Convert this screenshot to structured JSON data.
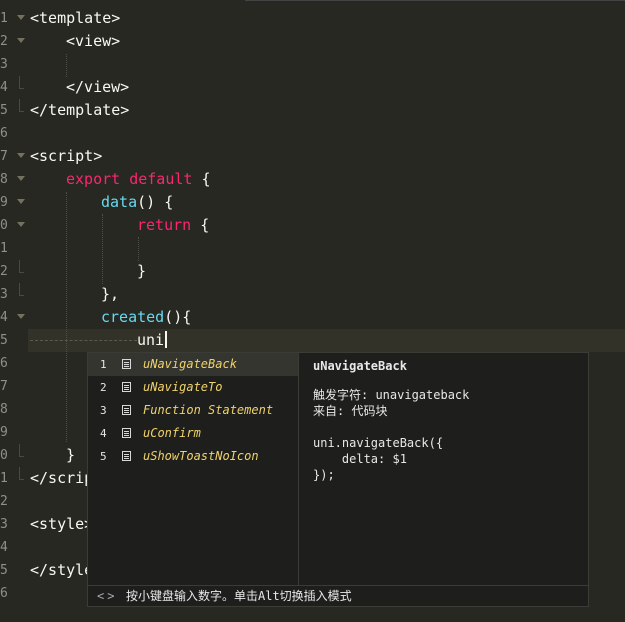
{
  "editor": {
    "lines": [
      {
        "num": "1",
        "code": "<template>"
      },
      {
        "num": "2",
        "code": "<view>"
      },
      {
        "num": "3",
        "code": ""
      },
      {
        "num": "4",
        "code": "</view>"
      },
      {
        "num": "5",
        "code": "</template>"
      },
      {
        "num": "6",
        "code": ""
      },
      {
        "num": "7",
        "code": "<script>"
      },
      {
        "num": "8",
        "code_kw": "export default",
        "code_rest": " {"
      },
      {
        "num": "9",
        "code_fn": "data",
        "code_rest": "() {"
      },
      {
        "num": "0",
        "code_kw": "return",
        "code_rest": " {"
      },
      {
        "num": "1",
        "code": ""
      },
      {
        "num": "2",
        "code": "}"
      },
      {
        "num": "3",
        "code": "},"
      },
      {
        "num": "4",
        "code_fn": "created",
        "code_rest": "(){"
      },
      {
        "num": "5",
        "code": "uni"
      },
      {
        "num": "6",
        "code": ""
      },
      {
        "num": "7",
        "code": ""
      },
      {
        "num": "8",
        "code": ""
      },
      {
        "num": "9",
        "code": ""
      },
      {
        "num": "0",
        "code": "}"
      },
      {
        "num": "1",
        "code": "</scrip"
      },
      {
        "num": "2",
        "code": ""
      },
      {
        "num": "3",
        "code": "<style>"
      },
      {
        "num": "4",
        "code": ""
      },
      {
        "num": "5",
        "code": "</style"
      },
      {
        "num": "6",
        "code": ""
      }
    ]
  },
  "autocomplete": {
    "items": [
      {
        "index": "1",
        "label": "uNavigateBack",
        "icon": "snippet-icon"
      },
      {
        "index": "2",
        "label": "uNavigateTo",
        "icon": "snippet-icon"
      },
      {
        "index": "3",
        "label": "Function Statement",
        "icon": "snippet-icon"
      },
      {
        "index": "4",
        "label": "uConfirm",
        "icon": "snippet-icon"
      },
      {
        "index": "5",
        "label": "uShowToastNoIcon",
        "icon": "snippet-icon"
      }
    ],
    "selected_index": 0,
    "detail": {
      "title": "uNavigateBack",
      "trigger": "触发字符: unavigateback",
      "source": "来自: 代码块",
      "body": "uni.navigateBack({\n    delta: $1\n});"
    },
    "footer": {
      "nav_prev": "<",
      "nav_next": ">",
      "hint": "按小键盘输入数字。单击Alt切换插入模式"
    }
  },
  "colors": {
    "background": "#272822",
    "tag": "#f92672",
    "keyword": "#f92672",
    "function": "#66d9ef",
    "completion_label": "#f0d26a"
  }
}
